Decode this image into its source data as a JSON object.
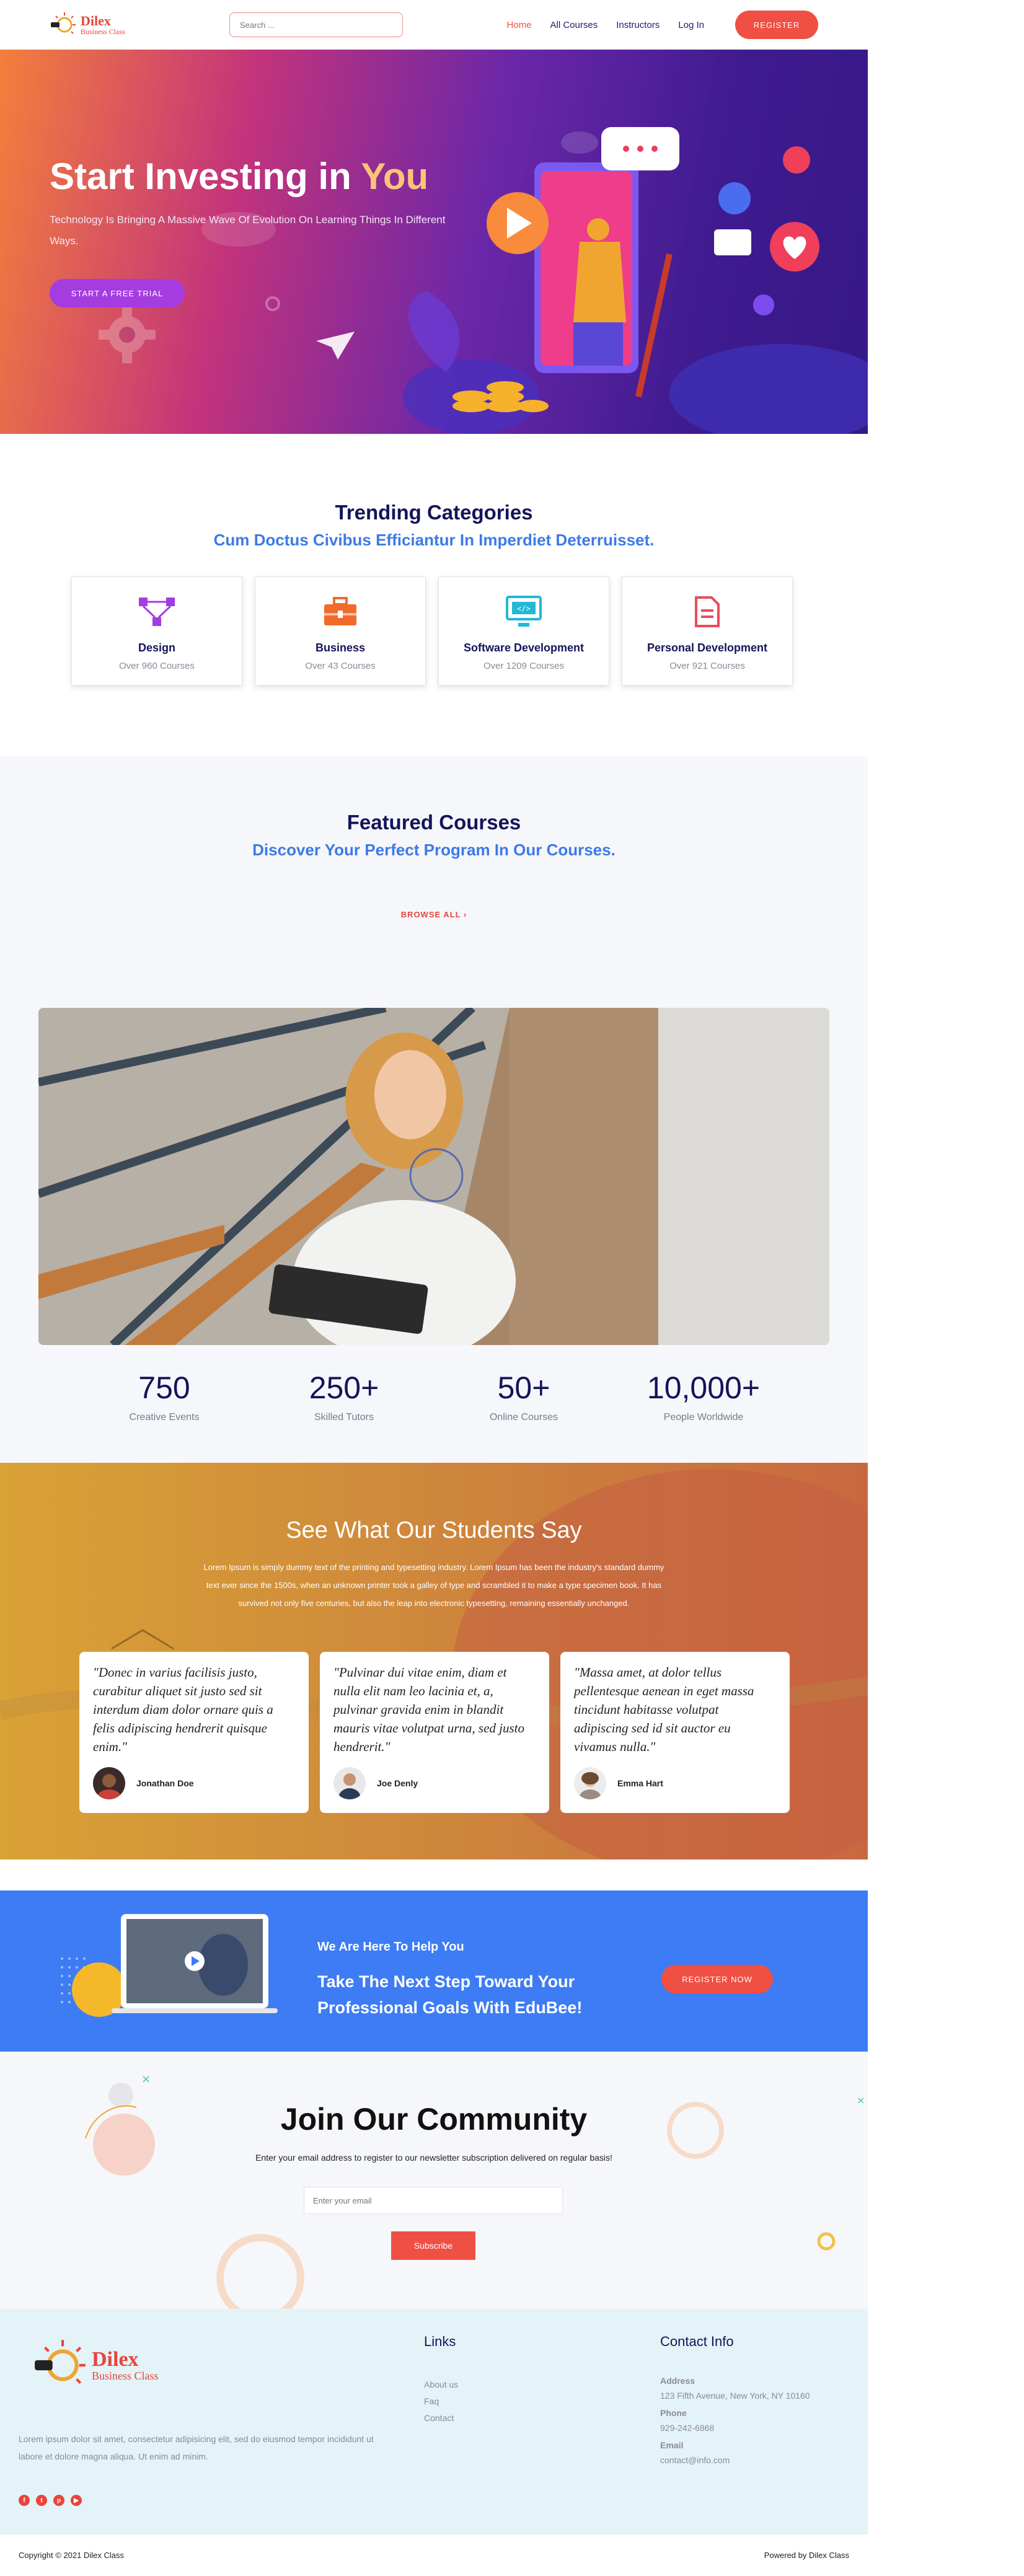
{
  "header": {
    "logo_title": "Dilex",
    "logo_sub": "Business Class",
    "search_placeholder": "Search ...",
    "nav": [
      {
        "label": "Home",
        "active": true
      },
      {
        "label": "All Courses"
      },
      {
        "label": "Instructors"
      },
      {
        "label": "Log In"
      }
    ],
    "register_label": "REGISTER"
  },
  "hero": {
    "title_main": "Start Investing in",
    "title_accent": "You",
    "subtitle": "Technology Is Bringing A Massive Wave Of Evolution On Learning Things In Different Ways.",
    "cta_label": "START A FREE TRIAL",
    "colors": {
      "accent": "#fbc479",
      "button": "#a43ce0"
    }
  },
  "trending": {
    "title": "Trending Categories",
    "subtitle": "Cum Doctus Civibus Efficiantur In Imperdiet Deterruisset.",
    "categories": [
      {
        "name": "Design",
        "count": "Over 960 Courses",
        "icon": "design-icon",
        "color": "#a23de0"
      },
      {
        "name": "Business",
        "count": "Over 43 Courses",
        "icon": "briefcase-icon",
        "color": "#f06a2a"
      },
      {
        "name": "Software Development",
        "count": "Over 1209 Courses",
        "icon": "monitor-code-icon",
        "color": "#22b8d6"
      },
      {
        "name": "Personal Development",
        "count": "Over 921 Courses",
        "icon": "document-icon",
        "color": "#ec4a5c"
      }
    ]
  },
  "featured": {
    "title": "Featured Courses",
    "subtitle": "Discover Your Perfect Program In Our Courses.",
    "browse_label": "BROWSE ALL",
    "stats": [
      {
        "num": "750",
        "label": "Creative Events"
      },
      {
        "num": "250+",
        "label": "Skilled Tutors"
      },
      {
        "num": "50+",
        "label": "Online Courses"
      },
      {
        "num": "10,000+",
        "label": "People Worldwide"
      }
    ]
  },
  "testimonials": {
    "title": "See What Our Students Say",
    "intro": "Lorem Ipsum is simply dummy text of the printing and typesetting industry. Lorem Ipsum has been the industry's standard dummy text ever since the 1500s, when an unknown printer took a galley of type and scrambled it to make a type specimen book. It has survived not only five centuries, but also the leap into electronic typesetting, remaining essentially unchanged.",
    "items": [
      {
        "quote": "\"Donec in varius facilisis justo, curabitur aliquet sit justo sed sit interdum diam dolor ornare quis a felis adipiscing hendrerit quisque enim.\"",
        "name": "Jonathan Doe"
      },
      {
        "quote": "\"Pulvinar dui vitae enim, diam et nulla elit nam leo lacinia et, a, pulvinar gravida enim in blandit mauris vitae volutpat urna, sed justo hendrerit.\"",
        "name": "Joe Denly"
      },
      {
        "quote": "\"Massa amet, at dolor tellus pellentesque aenean in eget massa tincidunt habitasse volutpat adipiscing sed id sit auctor eu vivamus nulla.\"",
        "name": "Emma Hart"
      }
    ]
  },
  "cta": {
    "kicker": "We Are Here To Help You",
    "heading": "Take The Next Step Toward Your Professional Goals With EduBee!",
    "button_label": "REGISTER NOW"
  },
  "community": {
    "title": "Join Our Community",
    "description": "Enter your email address to register to our newsletter subscription delivered on regular basis!",
    "email_placeholder": "Enter your email",
    "button_label": "Subscribe"
  },
  "footer": {
    "logo_title": "Dilex",
    "logo_sub": "Business Class",
    "about": "Lorem ipsum dolor sit amet, consectetur adipisicing elit, sed do eiusmod tempor incididunt ut labore et dolore magna aliqua. Ut enim ad minim.",
    "links_title": "Links",
    "links": [
      "About us",
      "Faq",
      "Contact"
    ],
    "contact_title": "Contact Info",
    "contact": [
      {
        "label": "Address",
        "value": "123 Fifth Avenue, New York, NY 10160"
      },
      {
        "label": "Phone",
        "value": "929-242-6868"
      },
      {
        "label": "Email",
        "value": "contact@info.com"
      }
    ],
    "socials": [
      "facebook-icon",
      "twitter-icon",
      "pinterest-icon",
      "youtube-icon"
    ],
    "copyright": "Copyright © 2021 Dilex Class",
    "powered": "Powered by Dilex Class"
  }
}
